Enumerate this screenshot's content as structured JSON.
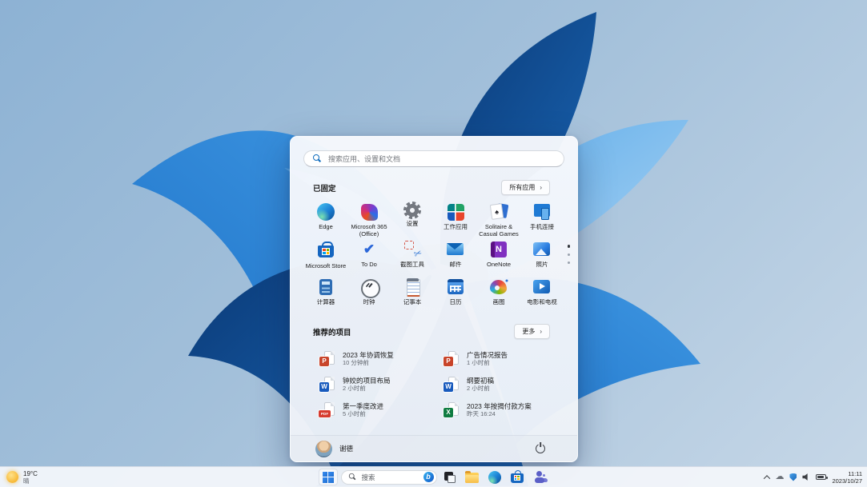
{
  "wallpaper": {
    "base_top_left": "#8db2d4",
    "base_bottom_right": "#c6d7e7",
    "bloom_deep": "#0b3a77",
    "bloom_mid": "#1f74c9",
    "bloom_light": "#74b7ec"
  },
  "start_menu": {
    "search": {
      "placeholder": "搜索应用、设置和文档"
    },
    "pinned": {
      "title": "已固定",
      "all_apps_button": "所有应用",
      "chevron": "›",
      "apps": [
        {
          "label": "Edge",
          "icon": "edge"
        },
        {
          "label": "Microsoft 365 (Office)",
          "icon": "m365"
        },
        {
          "label": "设置",
          "icon": "settings"
        },
        {
          "label": "工作应用",
          "icon": "workapps"
        },
        {
          "label": "Solitaire & Casual Games",
          "icon": "solitaire"
        },
        {
          "label": "手机连接",
          "icon": "phone"
        },
        {
          "label": "Microsoft Store",
          "icon": "store"
        },
        {
          "label": "To Do",
          "icon": "todo"
        },
        {
          "label": "截图工具",
          "icon": "snip"
        },
        {
          "label": "邮件",
          "icon": "mail"
        },
        {
          "label": "OneNote",
          "icon": "onenote"
        },
        {
          "label": "照片",
          "icon": "photos"
        },
        {
          "label": "计算器",
          "icon": "calculator"
        },
        {
          "label": "时钟",
          "icon": "clock"
        },
        {
          "label": "记事本",
          "icon": "notepad"
        },
        {
          "label": "日历",
          "icon": "calendar"
        },
        {
          "label": "画图",
          "icon": "paint"
        },
        {
          "label": "电影和电视",
          "icon": "movies"
        }
      ],
      "page_dots": {
        "count": 3,
        "active_index": 0
      }
    },
    "recommended": {
      "title": "推荐的项目",
      "more_button": "更多",
      "chevron": "›",
      "items": [
        {
          "title": "2023 年协调恢复",
          "time": "10 分钟前",
          "icon": "ppt"
        },
        {
          "title": "广告情况报告",
          "time": "1 小时前",
          "icon": "ppt"
        },
        {
          "title": "钟姣的项目布局",
          "time": "2 小时前",
          "icon": "word"
        },
        {
          "title": "纲要初稿",
          "time": "2 小时前",
          "icon": "word"
        },
        {
          "title": "第一季度改进",
          "time": "5 小时前",
          "icon": "pdf"
        },
        {
          "title": "2023 年按揭付款方案",
          "time": "昨天 16:24",
          "icon": "excel"
        }
      ],
      "doc_badges": {
        "ppt": {
          "letter": "P",
          "color": "#c8442a"
        },
        "word": {
          "letter": "W",
          "color": "#185abd"
        },
        "pdf": {
          "letter": "PDF",
          "color": "#d63b2f"
        },
        "excel": {
          "letter": "X",
          "color": "#107c41"
        }
      }
    },
    "user": {
      "name": "谢德"
    }
  },
  "taskbar": {
    "weather": {
      "temperature": "19°C",
      "condition": "晴"
    },
    "search_label": "搜索",
    "bing_letter": "b",
    "buttons": [
      "start",
      "search",
      "task-view",
      "file-explorer",
      "edge",
      "store",
      "teams"
    ],
    "tray": {
      "time": "11:11",
      "date": "2023/10/27"
    }
  }
}
